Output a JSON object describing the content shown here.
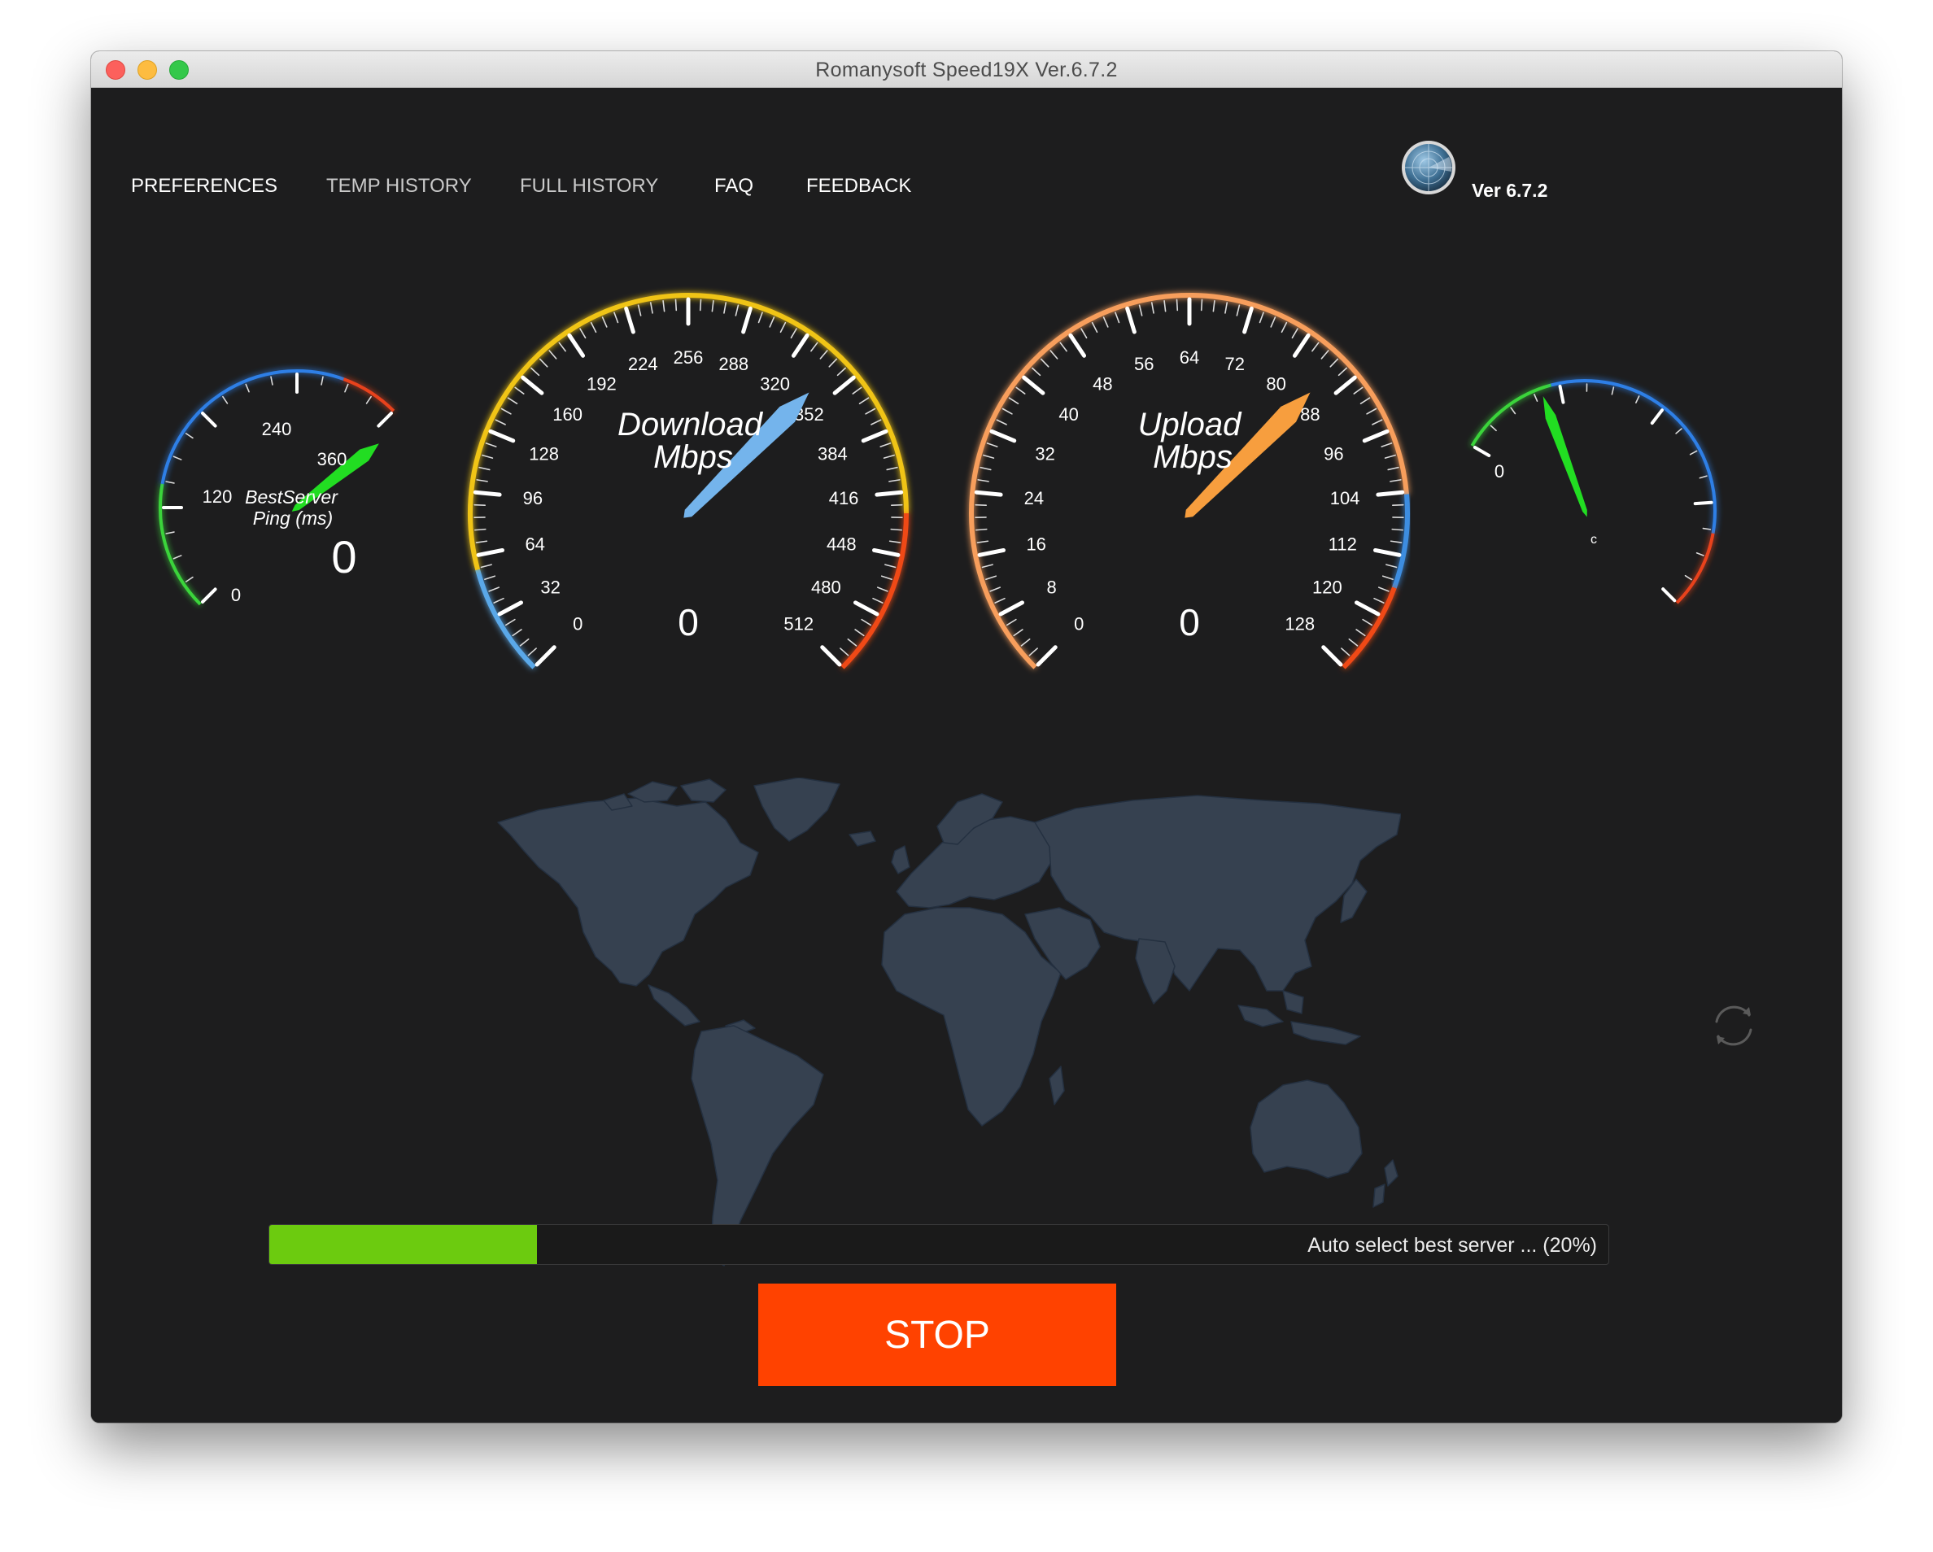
{
  "window": {
    "title": "Romanysoft Speed19X Ver.6.7.2"
  },
  "nav": [
    {
      "label": "PREFERENCES",
      "active": true
    },
    {
      "label": "TEMP HISTORY",
      "active": false
    },
    {
      "label": "FULL HISTORY",
      "active": false
    },
    {
      "label": "FAQ",
      "active": true
    },
    {
      "label": "FEEDBACK",
      "active": true
    }
  ],
  "version_label": "Ver 6.7.2",
  "gauges": {
    "ping": {
      "title_line1": "BestServer",
      "title_line2": "Ping (ms)",
      "ticks": [
        "0",
        "120",
        "240",
        "360"
      ],
      "value": "0",
      "colors": {
        "arc_low": "#3ad43a",
        "arc_mid": "#2f7fe6",
        "arc_high": "#e8421e",
        "needle": "#22dd22"
      }
    },
    "download": {
      "title_line1": "Download",
      "title_line2": "Mbps",
      "ticks": [
        "0",
        "32",
        "64",
        "96",
        "128",
        "160",
        "192",
        "224",
        "256",
        "288",
        "320",
        "352",
        "384",
        "416",
        "448",
        "480",
        "512"
      ],
      "value": "0",
      "colors": {
        "arc": "#f0c419",
        "arc_start": "#5aa8e8",
        "arc_end": "#f04a14",
        "needle": "#74b4ec"
      }
    },
    "upload": {
      "title_line1": "Upload",
      "title_line2": "Mbps",
      "ticks": [
        "0",
        "8",
        "16",
        "24",
        "32",
        "40",
        "48",
        "56",
        "64",
        "72",
        "80",
        "88",
        "96",
        "104",
        "112",
        "120",
        "128"
      ],
      "value": "0",
      "colors": {
        "arc": "#f79e5c",
        "arc_end_blue": "#3d8de0",
        "arc_end_red": "#f04a14",
        "needle": "#f79e3e"
      }
    },
    "jitter": {
      "ticks": [
        "0"
      ],
      "needle_label": "c",
      "colors": {
        "arc_low": "#3ad43a",
        "arc_mid": "#2f7fe6",
        "arc_high": "#e8421e",
        "needle": "#22dd22"
      }
    }
  },
  "progress": {
    "text": "Auto select best server ... (20%)",
    "fraction": 0.2,
    "color": "#6ccb0f"
  },
  "stop_button": {
    "label": "STOP",
    "color": "#ff4200"
  },
  "icons": {
    "logo": "globe-radar-icon",
    "refresh": "refresh-icon"
  }
}
